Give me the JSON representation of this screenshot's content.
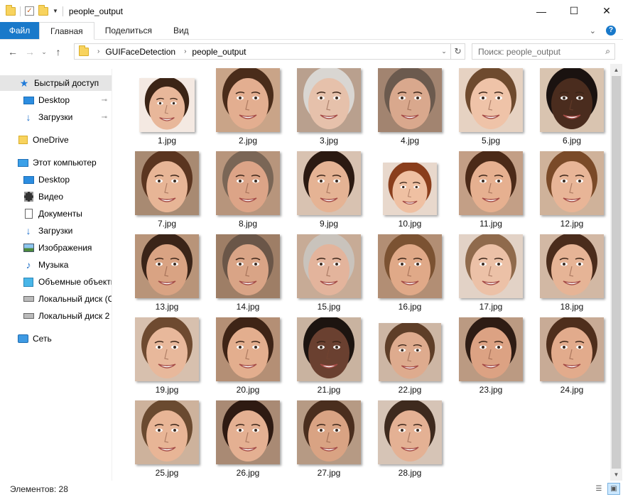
{
  "window": {
    "title": "people_output",
    "minimize": "—",
    "maximize": "☐",
    "close": "✕"
  },
  "ribbon": {
    "tabs": [
      "Файл",
      "Главная",
      "Поделиться",
      "Вид"
    ],
    "active_tab": "Главная",
    "expand": "⌄",
    "help": "?"
  },
  "address": {
    "back": "←",
    "forward": "→",
    "recent": "⌄",
    "up": "↑",
    "breadcrumb": [
      "GUIFaceDetection",
      "people_output"
    ],
    "separator": "›",
    "dropdown": "⌄",
    "refresh": "↻"
  },
  "search": {
    "placeholder": "Поиск: people_output",
    "icon": "search-icon"
  },
  "sidebar": {
    "items": [
      {
        "label": "Быстрый доступ",
        "icon": "star-icon",
        "pinned": false
      },
      {
        "label": "Desktop",
        "icon": "desktop-icon",
        "pinned": true
      },
      {
        "label": "Загрузки",
        "icon": "download-icon",
        "pinned": true
      },
      {
        "label": "OneDrive",
        "icon": "onedrive-icon",
        "pinned": false
      },
      {
        "label": "Этот компьютер",
        "icon": "computer-icon",
        "pinned": false
      },
      {
        "label": "Desktop",
        "icon": "desktop-icon",
        "pinned": false
      },
      {
        "label": "Видео",
        "icon": "video-icon",
        "pinned": false
      },
      {
        "label": "Документы",
        "icon": "documents-icon",
        "pinned": false
      },
      {
        "label": "Загрузки",
        "icon": "download-icon",
        "pinned": false
      },
      {
        "label": "Изображения",
        "icon": "pictures-icon",
        "pinned": false
      },
      {
        "label": "Музыка",
        "icon": "music-icon",
        "pinned": false
      },
      {
        "label": "Объемные объекты",
        "icon": "3d-objects-icon",
        "pinned": false
      },
      {
        "label": "Локальный диск (C",
        "icon": "disk-icon",
        "pinned": false
      },
      {
        "label": "Локальный диск 2",
        "icon": "disk-icon",
        "pinned": false
      },
      {
        "label": "Сеть",
        "icon": "network-icon",
        "pinned": false
      }
    ],
    "pin_glyph": "📌"
  },
  "files": [
    {
      "name": "1.jpg",
      "skin": "#e8b79a",
      "hair": "#3b2416",
      "bg": "#f4e9e2"
    },
    {
      "name": "2.jpg",
      "skin": "#e3ae90",
      "hair": "#4a2c1a",
      "bg": "#c9a488"
    },
    {
      "name": "3.jpg",
      "skin": "#e6c1ab",
      "hair": "#d9d6d2",
      "bg": "#b9a08e"
    },
    {
      "name": "4.jpg",
      "skin": "#d9a88d",
      "hair": "#6b5a4e",
      "bg": "#a28470"
    },
    {
      "name": "5.jpg",
      "skin": "#efc3a8",
      "hair": "#6e4a2e",
      "bg": "#e6d2c2"
    },
    {
      "name": "6.jpg",
      "skin": "#4a2c1e",
      "hair": "#1a1210",
      "bg": "#d9c4b0"
    },
    {
      "name": "7.jpg",
      "skin": "#e7b596",
      "hair": "#5a3520",
      "bg": "#a88a72"
    },
    {
      "name": "8.jpg",
      "skin": "#dca487",
      "hair": "#7a6656",
      "bg": "#b7957c"
    },
    {
      "name": "9.jpg",
      "skin": "#e5b394",
      "hair": "#2b1a12",
      "bg": "#d8c2b1"
    },
    {
      "name": "10.jpg",
      "skin": "#efc0a2",
      "hair": "#8a3e1c",
      "bg": "#e8d8cc"
    },
    {
      "name": "11.jpg",
      "skin": "#e6b090",
      "hair": "#4b2a18",
      "bg": "#c39f86"
    },
    {
      "name": "12.jpg",
      "skin": "#e8b597",
      "hair": "#7a4a28",
      "bg": "#cfb29a"
    },
    {
      "name": "13.jpg",
      "skin": "#d9a383",
      "hair": "#3a2418",
      "bg": "#b89479"
    },
    {
      "name": "14.jpg",
      "skin": "#d9a486",
      "hair": "#6a5648",
      "bg": "#9e7e66"
    },
    {
      "name": "15.jpg",
      "skin": "#e3b49c",
      "hair": "#c9c3bc",
      "bg": "#c7ab96"
    },
    {
      "name": "16.jpg",
      "skin": "#e0a988",
      "hair": "#7b5232",
      "bg": "#b28e74"
    },
    {
      "name": "17.jpg",
      "skin": "#ecc1a7",
      "hair": "#8f6a4c",
      "bg": "#e2d2c6"
    },
    {
      "name": "18.jpg",
      "skin": "#e6b496",
      "hair": "#4a2c1c",
      "bg": "#d2b8a4"
    },
    {
      "name": "19.jpg",
      "skin": "#e8b89b",
      "hair": "#6e4a30",
      "bg": "#d7c0ae"
    },
    {
      "name": "20.jpg",
      "skin": "#e3ae8e",
      "hair": "#3e2416",
      "bg": "#b48f75"
    },
    {
      "name": "21.jpg",
      "skin": "#6a4030",
      "hair": "#1c1410",
      "bg": "#c9b3a0"
    },
    {
      "name": "22.jpg",
      "skin": "#deab8e",
      "hair": "#5e3e28",
      "bg": "#cdb6a4"
    },
    {
      "name": "23.jpg",
      "skin": "#dca283",
      "hair": "#2e1c14",
      "bg": "#bb9a82"
    },
    {
      "name": "24.jpg",
      "skin": "#e2ab8c",
      "hair": "#4e2e1c",
      "bg": "#c8ab96"
    },
    {
      "name": "25.jpg",
      "skin": "#e8b596",
      "hair": "#6a4a30",
      "bg": "#cdb29c"
    },
    {
      "name": "26.jpg",
      "skin": "#e4b092",
      "hair": "#2e1a12",
      "bg": "#a98a74"
    },
    {
      "name": "27.jpg",
      "skin": "#d9a383",
      "hair": "#4a2e1e",
      "bg": "#b69a84"
    },
    {
      "name": "28.jpg",
      "skin": "#e4b194",
      "hair": "#3e2a1e",
      "bg": "#d6c4b6"
    }
  ],
  "status": {
    "count_text": "Элементов: 28"
  },
  "colors": {
    "accent": "#1979ca",
    "selection": "#e5e5e5"
  }
}
